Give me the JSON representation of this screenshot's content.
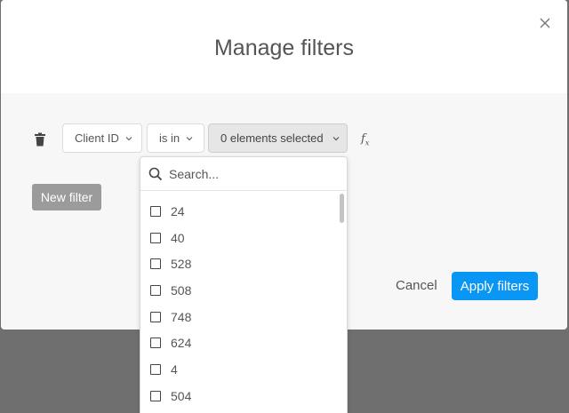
{
  "modal": {
    "title": "Manage filters"
  },
  "filter": {
    "field_label": "Client ID",
    "operator_label": "is in",
    "value_label": "0 elements selected",
    "fx_label": "f",
    "fx_sub": "x"
  },
  "dropdown": {
    "search_placeholder": "Search...",
    "options": [
      "24",
      "40",
      "528",
      "508",
      "748",
      "624",
      "4",
      "504"
    ]
  },
  "buttons": {
    "new_filter": "New filter",
    "cancel": "Cancel",
    "apply": "Apply filters"
  },
  "colors": {
    "accent": "#0a96f4",
    "overlay": "#6f6f6f",
    "new_filter_bg": "#9b9b9b"
  },
  "icons": {
    "close": "close-icon",
    "trash": "trash-icon",
    "chevron": "chevron-down-icon",
    "search": "search-icon",
    "fx": "function-icon"
  }
}
